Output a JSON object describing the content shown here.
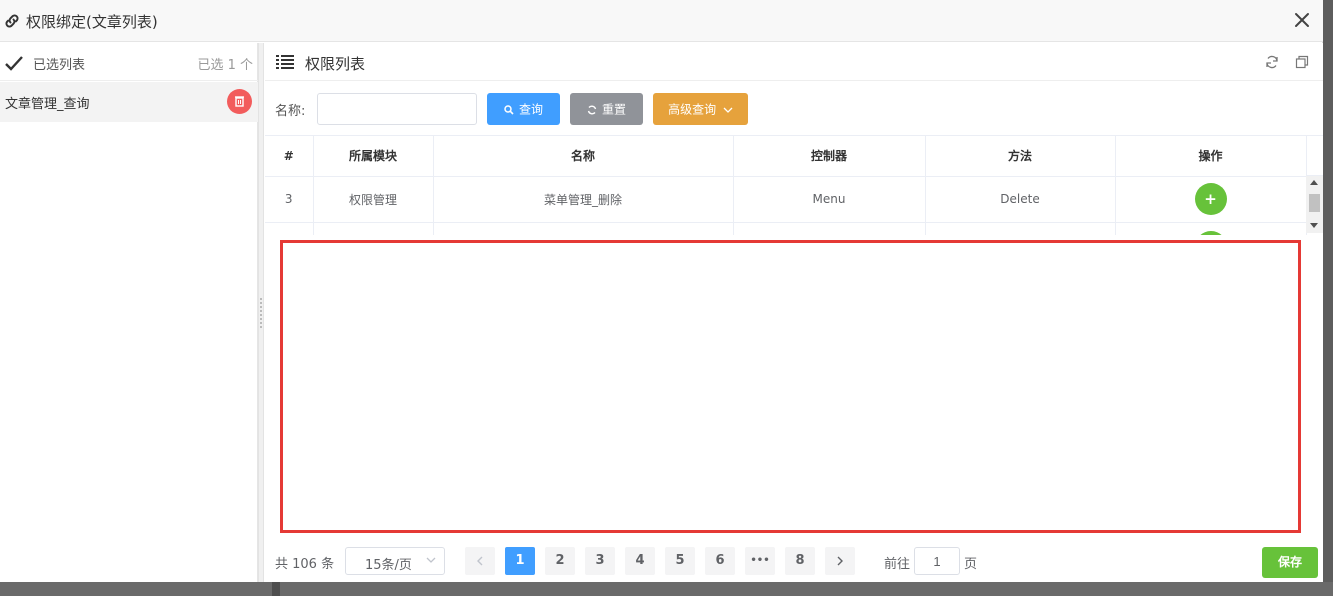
{
  "dialog": {
    "title": "权限绑定(文章列表)"
  },
  "left": {
    "title": "已选列表",
    "count": "已选 1 个",
    "items": [
      {
        "name": "文章管理_查询"
      }
    ]
  },
  "right": {
    "title": "权限列表",
    "search": {
      "label": "名称:",
      "value": "",
      "search_btn": "查询",
      "reset_btn": "重置",
      "advanced_btn": "高级查询"
    },
    "table": {
      "headers": [
        "#",
        "所属模块",
        "名称",
        "控制器",
        "方法",
        "操作"
      ],
      "rows": [
        {
          "index": "3",
          "module": "权限管理",
          "name": "菜单管理_删除",
          "controller": "Menu",
          "method": "Delete",
          "action": "+"
        }
      ]
    }
  },
  "pagination": {
    "total": "共 106 条",
    "page_size": "15条/页",
    "pages": [
      "1",
      "2",
      "3",
      "4",
      "5",
      "6",
      "•••",
      "8"
    ],
    "current": "1",
    "goto_label": "前往",
    "goto_value": "1",
    "page_unit": "页"
  },
  "save_label": "保存",
  "colors": {
    "primary": "#409eff",
    "success": "#67c23a",
    "warning": "#e6a23c",
    "info": "#909399",
    "danger": "#f25c5c",
    "highlight": "#e53935"
  }
}
